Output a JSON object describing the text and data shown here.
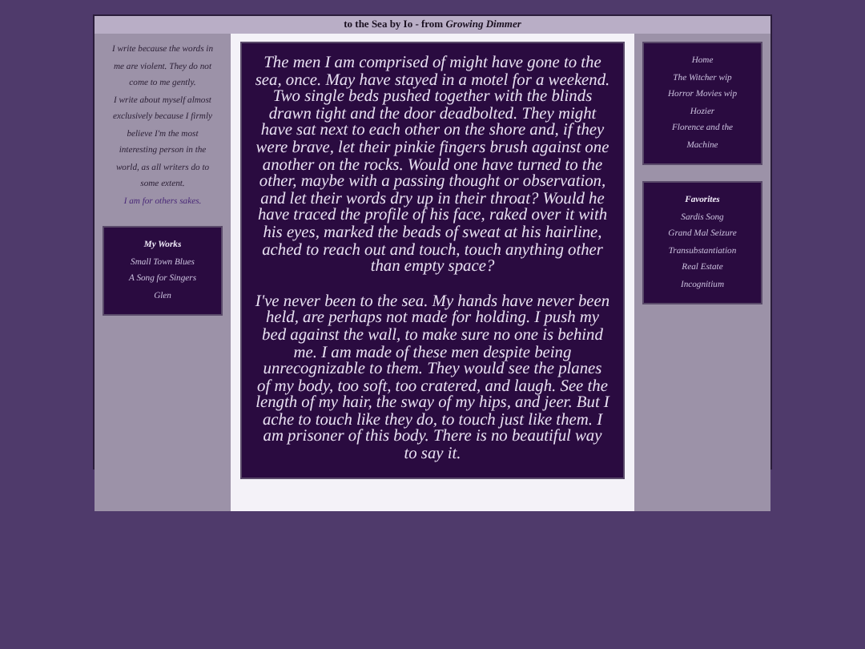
{
  "header": {
    "title": "to the Sea by Io - from *Growing Dimmer*"
  },
  "left": {
    "intro": [
      "I write because the words in me are violent. They do not come to me gently.",
      "I write about myself almost exclusively because I firmly believe I'm the most interesting person in the world, as all writers do to some extent."
    ],
    "tagline": "I am for others sakes.",
    "works": {
      "heading": "My Works",
      "items": [
        "Small Town Blues",
        "A Song for Singers",
        "Glen"
      ]
    }
  },
  "main": {
    "paragraphs": [
      "The men I am comprised of might have gone to the sea, once. May have stayed in a motel for a weekend. Two single beds pushed together with the blinds drawn tight and the door deadbolted. They might have sat next to each other on the shore and, if they were brave, let their pinkie fingers brush against one another on the rocks. Would one have turned to the other, maybe with a passing thought or observation, and let their words dry up in their throat? Would he have traced the profile of his face, raked over it with his eyes, marked the beads of sweat at his hairline, ached to reach out and touch, touch anything other than empty space?",
      "I've never been to the sea. My hands have never been held, are perhaps not made for holding. I push my bed against the wall, to make sure no one is behind me. I am made of these men despite being unrecognizable to them. They would see the planes of my body, too soft, too cratered, and laugh. See the length of my hair, the sway of my hips, and jeer. But I ache to touch like they do, to touch just like them. I am prisoner of this body. There is no beautiful way to say it."
    ]
  },
  "right": {
    "nav": [
      "Home",
      "The Witcher wip",
      "Horror Movies wip",
      "Hozier",
      "Florence and the Machine"
    ],
    "favorites": {
      "heading": "Favorites",
      "items": [
        "Sardis Song",
        "Grand Mal Seizure",
        "Transubstantiation",
        "Real Estate",
        "Incognitium"
      ]
    }
  }
}
